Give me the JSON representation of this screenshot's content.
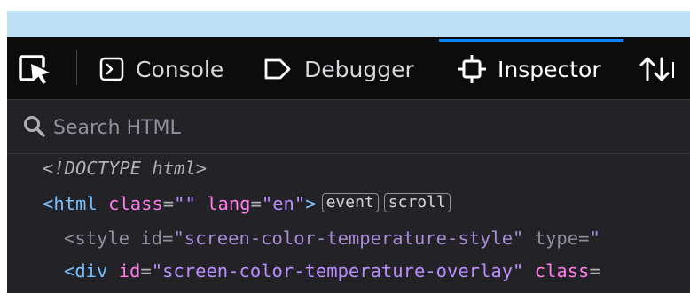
{
  "toolbar": {
    "tabs": [
      {
        "label": "Console",
        "icon": "console-icon"
      },
      {
        "label": "Debugger",
        "icon": "debugger-icon"
      },
      {
        "label": "Inspector",
        "icon": "inspector-icon",
        "active": true
      },
      {
        "label": "",
        "icon": "network-icon"
      }
    ]
  },
  "search": {
    "placeholder": "Search HTML"
  },
  "markup": {
    "doctype": "<!DOCTYPE html>",
    "html_line": {
      "tag_open": "<html",
      "attr1": "class",
      "eq1": "=",
      "val1": "\"\"",
      "attr2": "lang",
      "eq2": "=",
      "val2": "\"en\"",
      "tag_close": ">",
      "badge1": "event",
      "badge2": "scroll"
    },
    "style_line": {
      "tag_open": "<style",
      "attr1": "id",
      "eq1": "=",
      "val1": "\"screen-color-temperature-style\"",
      "attr2": "type",
      "eq2": "=",
      "val2": "\""
    },
    "div_line": {
      "tag_open": "<div",
      "attr1": "id",
      "eq1": "=",
      "val1": "\"screen-color-temperature-overlay\"",
      "attr2": "class",
      "eq2": "="
    }
  },
  "colors": {
    "accent": "#0a84ff",
    "toolbar_bg": "#0c0c0d",
    "panel_bg": "#232327",
    "top_strip": "#bde0f4"
  }
}
